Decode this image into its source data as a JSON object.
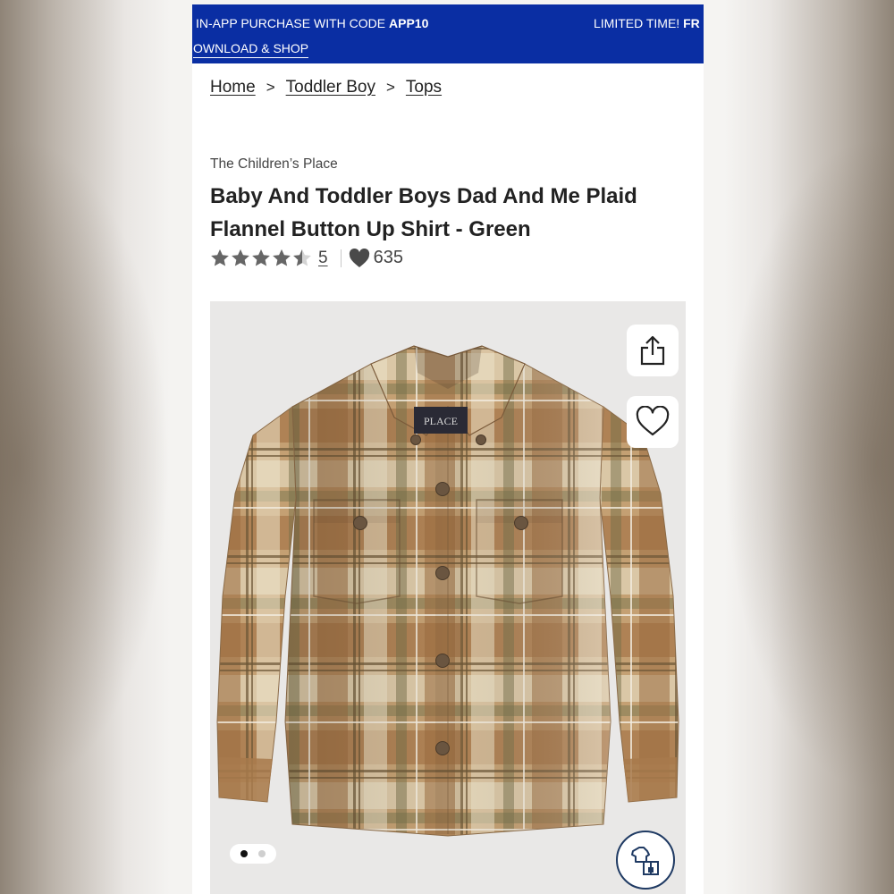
{
  "promo": {
    "line1_prefix": "IN-APP PURCHASE WITH CODE ",
    "code": "APP10",
    "right_prefix": "LIMITED TIME! ",
    "right_bold": "FR",
    "line2": "OWNLOAD & SHOP",
    "bg_color": "#0a2ea3"
  },
  "breadcrumb": {
    "items": [
      "Home",
      "Toddler Boy",
      "Tops"
    ],
    "separator": ">"
  },
  "product": {
    "brand": "The Children’s Place",
    "title": "Baby And Toddler Boys Dad And Me Plaid Flannel Button Up Shirt - Green",
    "rating": 4.5,
    "review_count": "5",
    "favorite_count": "635"
  },
  "gallery": {
    "image_label": "PLACE",
    "current_image": 1,
    "total_images": 2,
    "icons": [
      "share-icon",
      "heart-icon",
      "try-on-icon"
    ]
  }
}
